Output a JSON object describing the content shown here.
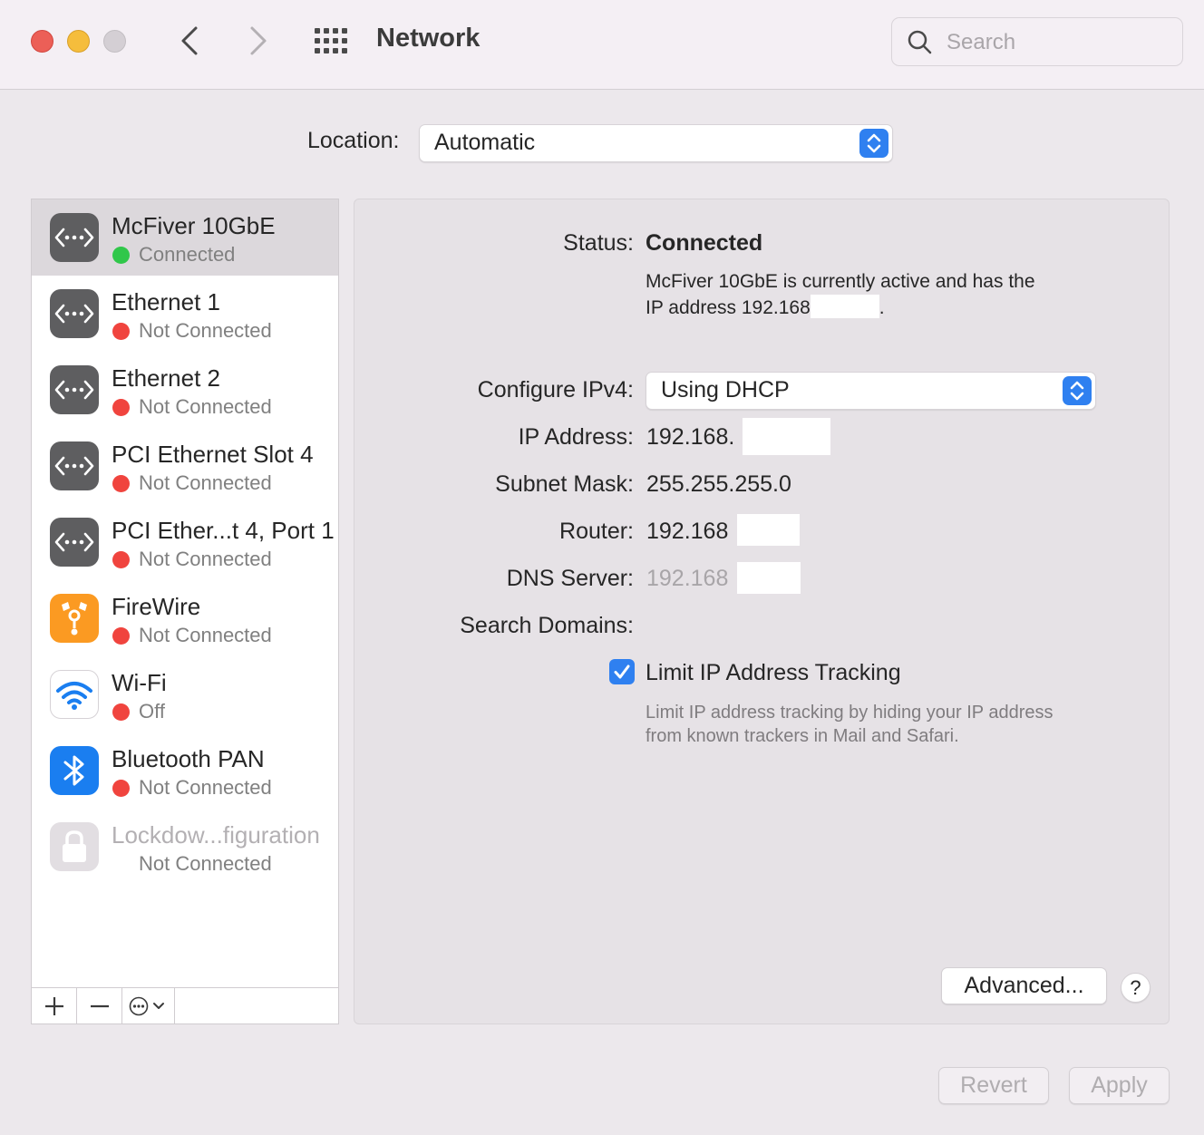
{
  "window": {
    "title": "Network",
    "search_placeholder": "Search"
  },
  "location": {
    "label": "Location:",
    "value": "Automatic"
  },
  "services": [
    {
      "name": "McFiver 10GbE",
      "status": "Connected",
      "status_color": "#30c74a",
      "icon": "ethernet-icon",
      "selected": true
    },
    {
      "name": "Ethernet 1",
      "status": "Not Connected",
      "status_color": "#f0443e",
      "icon": "ethernet-icon"
    },
    {
      "name": "Ethernet 2",
      "status": "Not Connected",
      "status_color": "#f0443e",
      "icon": "ethernet-icon"
    },
    {
      "name": "PCI Ethernet Slot 4",
      "status": "Not Connected",
      "status_color": "#f0443e",
      "icon": "ethernet-icon"
    },
    {
      "name": "PCI Ether...t 4, Port 1",
      "status": "Not Connected",
      "status_color": "#f0443e",
      "icon": "ethernet-icon"
    },
    {
      "name": "FireWire",
      "status": "Not Connected",
      "status_color": "#f0443e",
      "icon": "firewire-icon"
    },
    {
      "name": "Wi-Fi",
      "status": "Off",
      "status_color": "#f0443e",
      "icon": "wifi-icon"
    },
    {
      "name": "Bluetooth PAN",
      "status": "Not Connected",
      "status_color": "#f0443e",
      "icon": "bluetooth-icon"
    },
    {
      "name": "Lockdow...figuration",
      "status": "Not Connected",
      "icon": "lock-icon",
      "disabled": true
    }
  ],
  "toolbar": {
    "add": "+",
    "remove": "−"
  },
  "detail": {
    "status_label": "Status:",
    "status_value": "Connected",
    "status_desc_line1": "McFiver 10GbE is currently active and has the",
    "status_desc_line2": "IP address 192.168",
    "status_desc_end": ".",
    "configure_label": "Configure IPv4:",
    "configure_value": "Using DHCP",
    "ip_label": "IP Address:",
    "ip_value": "192.168.",
    "subnet_label": "Subnet Mask:",
    "subnet_value": "255.255.255.0",
    "router_label": "Router:",
    "router_value": "192.168",
    "dns_label": "DNS Server:",
    "dns_value": "192.168",
    "search_domains_label": "Search Domains:",
    "limit_tracking_label": "Limit IP Address Tracking",
    "limit_tracking_checked": true,
    "limit_desc_line1": "Limit IP address tracking by hiding your IP address",
    "limit_desc_line2": "from known trackers in Mail and Safari.",
    "advanced_button": "Advanced...",
    "help_button": "?"
  },
  "footer": {
    "revert_button": "Revert",
    "apply_button": "Apply"
  },
  "colors": {
    "accent": "#2f80f0",
    "connected": "#30c74a",
    "not_connected": "#f0443e"
  }
}
